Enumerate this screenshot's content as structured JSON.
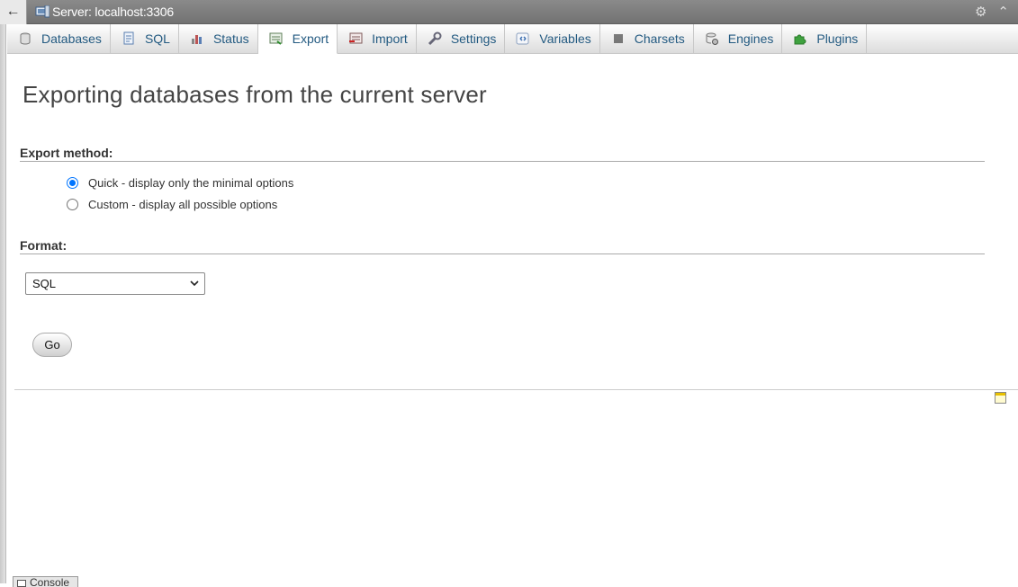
{
  "topbar": {
    "back_label": "←",
    "title": "Server: localhost:3306",
    "settings_icon": "gear-icon",
    "collapse_icon": "collapse-icon"
  },
  "tabs": [
    {
      "label": "Databases",
      "icon": "database-icon",
      "active": false
    },
    {
      "label": "SQL",
      "icon": "sql-icon",
      "active": false
    },
    {
      "label": "Status",
      "icon": "status-icon",
      "active": false
    },
    {
      "label": "Export",
      "icon": "export-icon",
      "active": true
    },
    {
      "label": "Import",
      "icon": "import-icon",
      "active": false
    },
    {
      "label": "Settings",
      "icon": "wrench-icon",
      "active": false
    },
    {
      "label": "Variables",
      "icon": "variables-icon",
      "active": false
    },
    {
      "label": "Charsets",
      "icon": "charsets-icon",
      "active": false
    },
    {
      "label": "Engines",
      "icon": "engines-icon",
      "active": false
    },
    {
      "label": "Plugins",
      "icon": "plugin-icon",
      "active": false
    }
  ],
  "main": {
    "title": "Exporting databases from the current server",
    "export_method_label": "Export method:",
    "options": [
      {
        "label": "Quick - display only the minimal options",
        "checked": true
      },
      {
        "label": "Custom - display all possible options",
        "checked": false
      }
    ],
    "format_label": "Format:",
    "format_value": "SQL",
    "go_label": "Go"
  },
  "console": {
    "label": "Console"
  },
  "colors": {
    "accent": "#235a81",
    "radio": "#0075ff",
    "topbar": "#7f7f7f"
  }
}
